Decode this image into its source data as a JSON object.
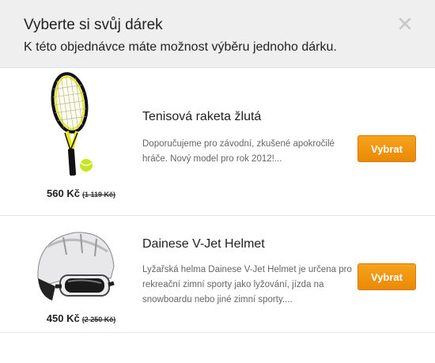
{
  "header": {
    "title": "Vyberte si svůj dárek",
    "subtitle": "K této objednávce máte možnost výběru jednoho dárku."
  },
  "gifts": [
    {
      "name": "Tenisová raketa žlutá",
      "description": "Doporučujeme pro závodní, zkušené apokročilé hráče. Nový model pro rok 2012!...",
      "price": "560 Kč",
      "old_price": "(1 119 Kč)",
      "button": "Vybrat",
      "image_icon": "tennis-racket-icon"
    },
    {
      "name": "Dainese V-Jet Helmet",
      "description": "Lyžařská helma Dainese V-Jet Helmet je určena pro rekreační zimní sporty jako lyžování, jízda na snowboardu nebo jiné zimní sporty....",
      "price": "450 Kč",
      "old_price": "(2 250 Kč)",
      "button": "Vybrat",
      "image_icon": "ski-helmet-icon"
    }
  ],
  "colors": {
    "accent": "#f39c12",
    "header_bg": "#efefef"
  }
}
